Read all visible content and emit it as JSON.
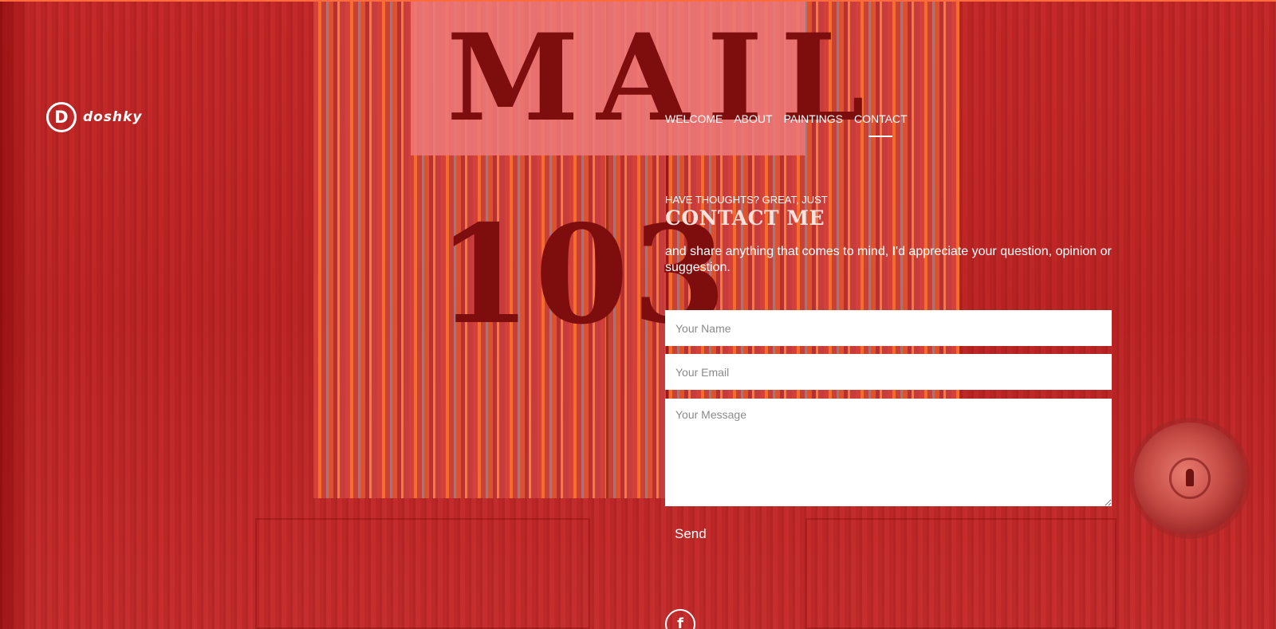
{
  "brand": {
    "logo_letter": "D",
    "name": "doshky"
  },
  "nav": {
    "items": [
      {
        "label": "WELCOME"
      },
      {
        "label": "ABOUT"
      },
      {
        "label": "PAINTINGS"
      },
      {
        "label": "CONTACT"
      }
    ],
    "active": "CONTACT"
  },
  "contact": {
    "eyebrow": "HAVE THOUGHTS? GREAT, JUST",
    "title": "CONTACT ME",
    "intro": "and share anything that comes to mind, I'd appreciate your question, opinion or suggestion."
  },
  "form": {
    "name_placeholder": "Your Name",
    "email_placeholder": "Your Email",
    "message_placeholder": "Your Message",
    "send_label": "Send"
  },
  "social": {
    "facebook_glyph": "f",
    "facebook_icon": "facebook-icon"
  },
  "background": {
    "sign_text_top": "MAIL",
    "sign_text_bottom": "103"
  },
  "colors": {
    "background": "#b82424",
    "accent_strip": "#ff6b3d",
    "text": "#ffffff",
    "title": "#ffe1dc"
  }
}
